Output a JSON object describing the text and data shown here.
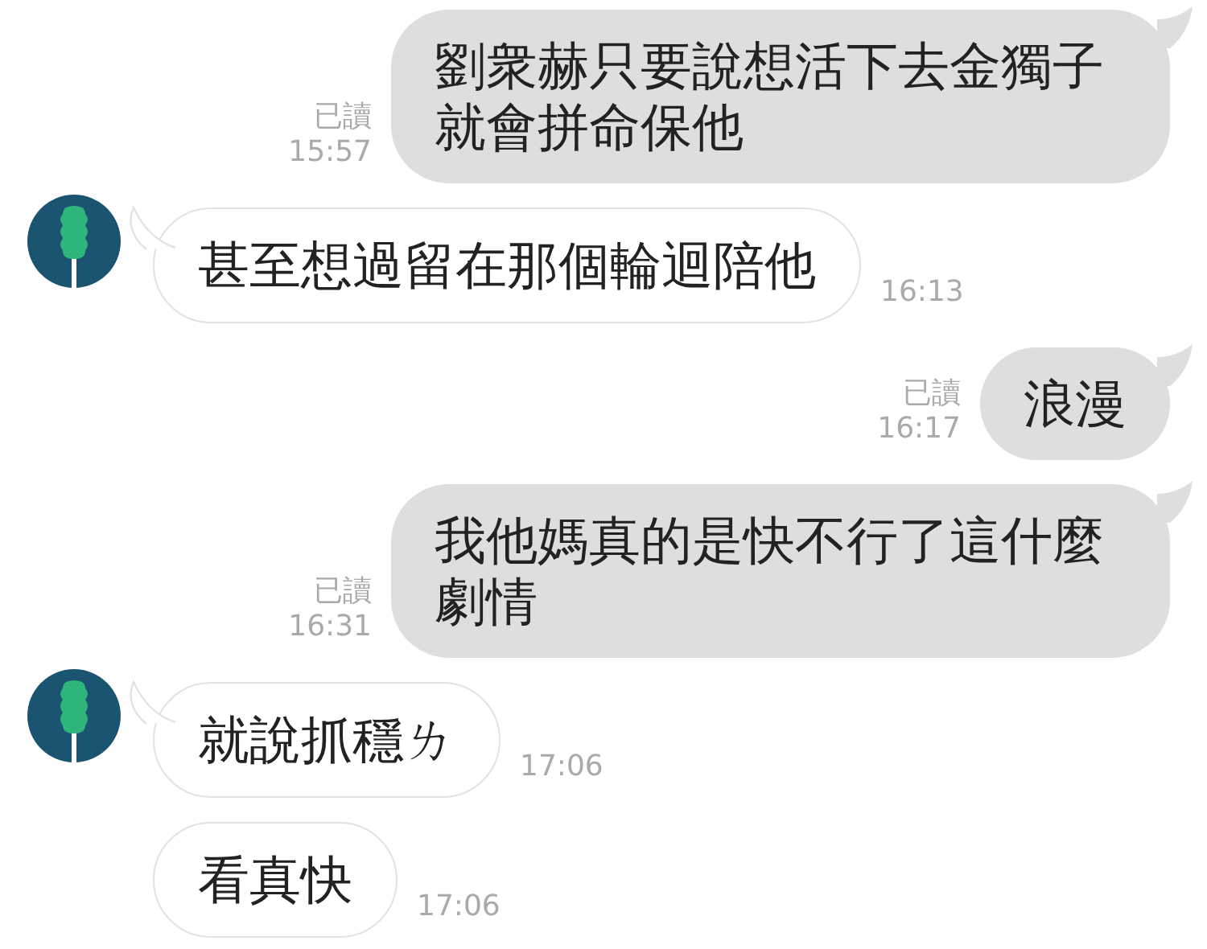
{
  "messages": [
    {
      "kind": "sent",
      "text": "劉衆赫只要說想活下去金獨子就會拼命保他",
      "read_label": "已讀",
      "time": "15:57",
      "tail": true
    },
    {
      "kind": "received",
      "text": "甚至想過留在那個輪迴陪他",
      "time": "16:13",
      "avatar": true
    },
    {
      "kind": "sent",
      "text": "浪漫",
      "read_label": "已讀",
      "time": "16:17",
      "tail": true
    },
    {
      "kind": "sent",
      "text": "我他媽真的是快不行了這什麼劇情",
      "read_label": "已讀",
      "time": "16:31",
      "tail": true
    },
    {
      "kind": "received",
      "text": "就說抓穩ㄌ",
      "time": "17:06",
      "avatar": true
    },
    {
      "kind": "received",
      "text": "看真快",
      "time": "17:06",
      "avatar": false
    }
  ]
}
